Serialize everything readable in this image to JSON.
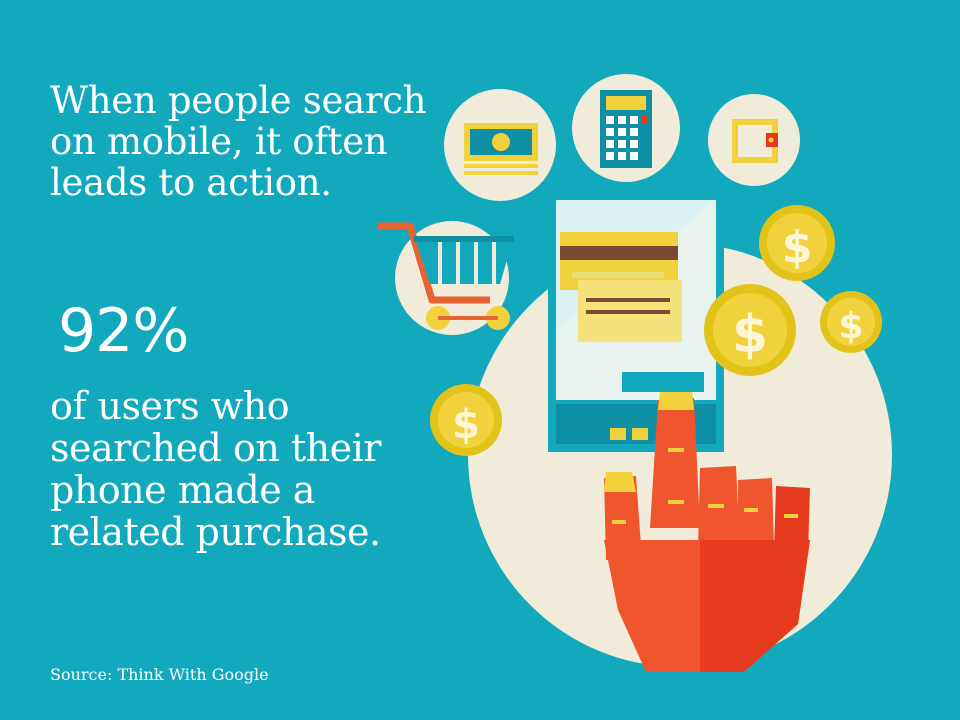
{
  "palette": {
    "background": "#12a9bd",
    "circle": "#f1ecd9",
    "yellow": "#f2d23c",
    "coin_gold": "#e2c31a",
    "teal_dark": "#0f8fa3",
    "hand_orange": "#f0562d",
    "hand_red": "#e63a1f",
    "brown": "#7a4b33"
  },
  "headline": "When people search on mobile, it often leads to action.",
  "stat": {
    "value": "92%",
    "description": "of users who searched on their phone made a related purchase."
  },
  "source": "Source: Think With Google",
  "illustration": {
    "icons": [
      "cash-icon",
      "calculator-icon",
      "wallet-icon",
      "shopping-cart-icon",
      "smartphone-icon",
      "credit-card-icon",
      "pointing-hand-icon",
      "dollar-coin-icon"
    ],
    "coin_symbol": "$"
  }
}
